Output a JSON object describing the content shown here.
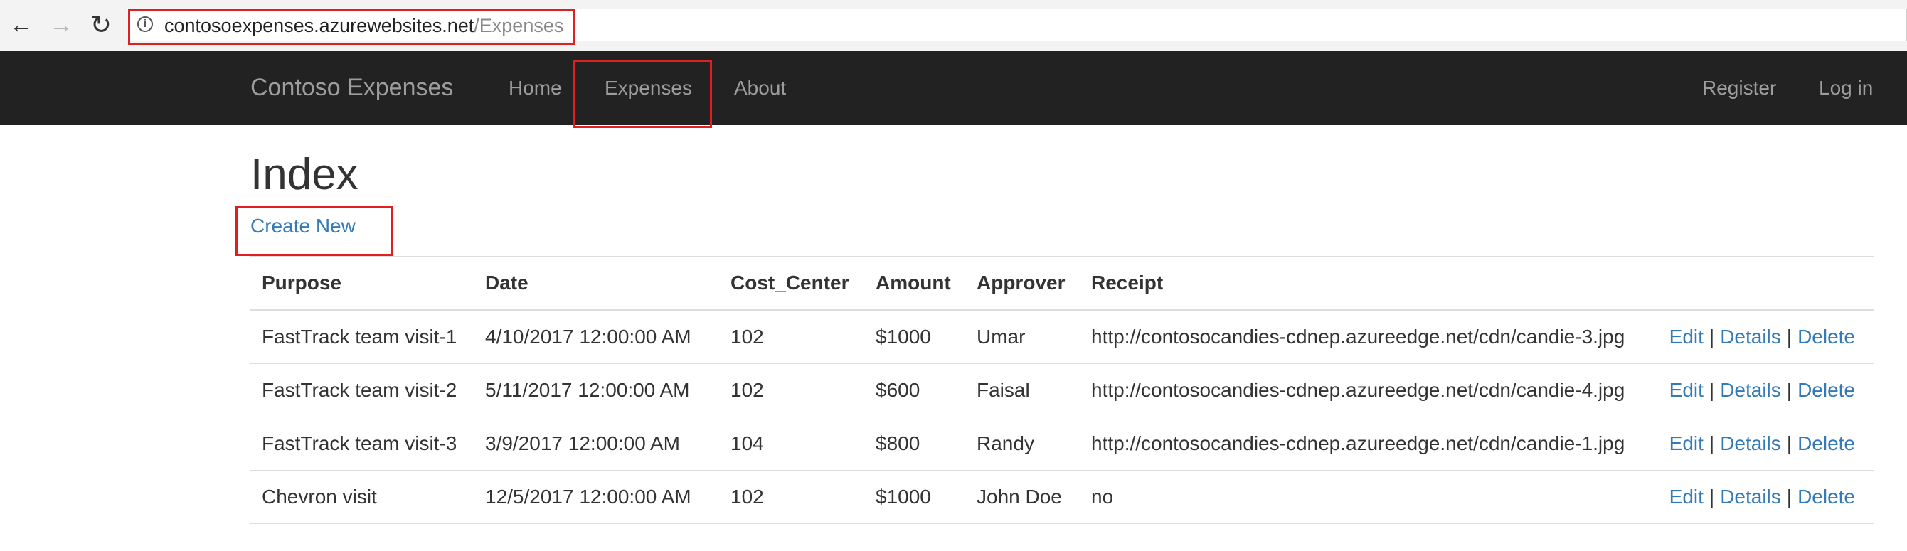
{
  "browser": {
    "back_icon": "←",
    "forward_icon": "→",
    "reload_icon": "↻",
    "info_icon": "i",
    "url_host": "contosoexpenses.azurewebsites.net",
    "url_path": "/Expenses"
  },
  "navbar": {
    "brand": "Contoso Expenses",
    "links": [
      "Home",
      "Expenses",
      "About"
    ],
    "right_links": [
      "Register",
      "Log in"
    ]
  },
  "main": {
    "title": "Index",
    "create_link": "Create New"
  },
  "table": {
    "headers": [
      "Purpose",
      "Date",
      "Cost_Center",
      "Amount",
      "Approver",
      "Receipt"
    ],
    "rows": [
      {
        "purpose": "FastTrack team visit-1",
        "date": "4/10/2017 12:00:00 AM",
        "cost_center": "102",
        "amount": "$1000",
        "approver": "Umar",
        "receipt": "http://contosocandies-cdnep.azureedge.net/cdn/candie-3.jpg"
      },
      {
        "purpose": "FastTrack team visit-2",
        "date": "5/11/2017 12:00:00 AM",
        "cost_center": "102",
        "amount": "$600",
        "approver": "Faisal",
        "receipt": "http://contosocandies-cdnep.azureedge.net/cdn/candie-4.jpg"
      },
      {
        "purpose": "FastTrack team visit-3",
        "date": "3/9/2017 12:00:00 AM",
        "cost_center": "104",
        "amount": "$800",
        "approver": "Randy",
        "receipt": "http://contosocandies-cdnep.azureedge.net/cdn/candie-1.jpg"
      },
      {
        "purpose": "Chevron visit",
        "date": "12/5/2017 12:00:00 AM",
        "cost_center": "102",
        "amount": "$1000",
        "approver": "John Doe",
        "receipt": "no"
      }
    ],
    "actions": {
      "edit": "Edit",
      "details": "Details",
      "delete": "Delete",
      "separator": "|"
    }
  },
  "colors": {
    "navbar_bg": "#222222",
    "nav_text": "#9d9d9d",
    "link": "#337ab7",
    "highlight": "#e02020"
  }
}
